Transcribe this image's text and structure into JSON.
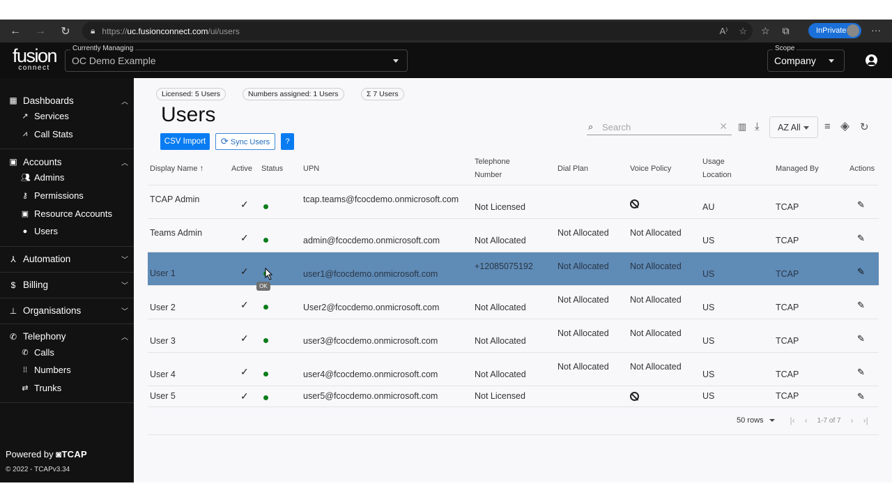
{
  "browser": {
    "url_scheme": "https://",
    "url_host": "uc.fusionconnect.com",
    "url_path": "/ui/users",
    "inprivate_label": "InPrivate",
    "icons": [
      "back-icon",
      "forward-icon",
      "refresh-icon",
      "lock-icon",
      "read-aloud-icon",
      "add-favorite-icon",
      "favorites-icon",
      "collections-icon",
      "more-icon"
    ]
  },
  "app": {
    "logo_top": "fusion",
    "logo_bottom": "connect",
    "managing_label": "Currently Managing",
    "managing_value": "OC Demo Example",
    "scope_label": "Scope",
    "scope_value": "Company"
  },
  "sidebar": {
    "groups": [
      {
        "label": "Dashboards",
        "icon": "dashboard-icon",
        "expanded": true,
        "items": [
          {
            "label": "Services",
            "icon": "hammer-icon"
          },
          {
            "label": "Call Stats",
            "icon": "chart-icon"
          }
        ]
      },
      {
        "label": "Accounts",
        "icon": "account-box-icon",
        "expanded": true,
        "items": [
          {
            "label": "Admins",
            "icon": "group-icon"
          },
          {
            "label": "Permissions",
            "icon": "key-icon"
          },
          {
            "label": "Resource Accounts",
            "icon": "account-box-icon"
          },
          {
            "label": "Users",
            "icon": "person-icon"
          }
        ]
      },
      {
        "label": "Automation",
        "icon": "automation-icon",
        "expanded": false,
        "items": []
      },
      {
        "label": "Billing",
        "icon": "dollar-icon",
        "expanded": false,
        "items": []
      },
      {
        "label": "Organisations",
        "icon": "sitemap-icon",
        "expanded": false,
        "items": []
      },
      {
        "label": "Telephony",
        "icon": "phone-icon",
        "expanded": true,
        "items": [
          {
            "label": "Calls",
            "icon": "phone-icon"
          },
          {
            "label": "Numbers",
            "icon": "dialpad-icon"
          },
          {
            "label": "Trunks",
            "icon": "trunk-icon"
          }
        ]
      }
    ],
    "powered_by": "Powered by",
    "powered_brand": "TCAP",
    "copyright": "© 2022 - TCAPv3.34"
  },
  "main": {
    "chips": [
      "Licensed: 5 Users",
      "Numbers assigned: 1 Users",
      "Σ 7 Users"
    ],
    "title": "Users",
    "buttons": {
      "csv_import": "CSV Import",
      "sync_users": "Sync Users",
      "help": "?"
    },
    "search": {
      "placeholder": "Search",
      "value": ""
    },
    "sort_label": "AZ All",
    "table": {
      "columns": [
        "Display Name",
        "Active",
        "Status",
        "UPN",
        "Telephone Number",
        "Dial Plan",
        "Voice Policy",
        "Usage Location",
        "Managed By",
        "Actions"
      ],
      "sort_column": "Display Name",
      "sort_direction": "ascending",
      "rows": [
        {
          "name": "TCAP Admin",
          "active": true,
          "status": "OK",
          "upn": "tcap.teams@fcocdemo.onmicrosoft.com",
          "phone": "Not Licensed",
          "dial_plan": "",
          "voice_policy": "blocked",
          "location": "AU",
          "managed_by": "TCAP"
        },
        {
          "name": "Teams Admin",
          "active": true,
          "status": "OK",
          "upn": "admin@fcocdemo.onmicrosoft.com",
          "phone": "Not Allocated",
          "dial_plan": "Not Allocated",
          "voice_policy": "Not Allocated",
          "location": "US",
          "managed_by": "TCAP"
        },
        {
          "name": "User 1",
          "active": true,
          "status": "OK",
          "upn": "user1@fcocdemo.onmicrosoft.com",
          "phone": "+12085075192",
          "dial_plan": "Not Allocated",
          "voice_policy": "Not Allocated",
          "location": "US",
          "managed_by": "TCAP",
          "selected": true
        },
        {
          "name": "User 2",
          "active": true,
          "status": "OK",
          "upn": "User2@fcocdemo.onmicrosoft.com",
          "phone": "Not Allocated",
          "dial_plan": "Not Allocated",
          "voice_policy": "Not Allocated",
          "location": "US",
          "managed_by": "TCAP"
        },
        {
          "name": "User 3",
          "active": true,
          "status": "OK",
          "upn": "user3@fcocdemo.onmicrosoft.com",
          "phone": "Not Allocated",
          "dial_plan": "Not Allocated",
          "voice_policy": "Not Allocated",
          "location": "US",
          "managed_by": "TCAP"
        },
        {
          "name": "User 4",
          "active": true,
          "status": "OK",
          "upn": "user4@fcocdemo.onmicrosoft.com",
          "phone": "Not Allocated",
          "dial_plan": "Not Allocated",
          "voice_policy": "Not Allocated",
          "location": "US",
          "managed_by": "TCAP"
        },
        {
          "name": "User 5",
          "active": true,
          "status": "OK",
          "upn": "user5@fcocdemo.onmicrosoft.com",
          "phone": "Not Licensed",
          "dial_plan": "",
          "voice_policy": "blocked",
          "location": "US",
          "managed_by": "TCAP"
        }
      ]
    },
    "tooltip": "OK",
    "pager": {
      "rows_per_page": "50 rows",
      "range": "1-7 of 7"
    }
  },
  "colors": {
    "primary": "#0a7cf2",
    "selected_row": "#5f8bb7",
    "status_ok": "#0b7d1b",
    "sidebar_bg": "#121212"
  }
}
